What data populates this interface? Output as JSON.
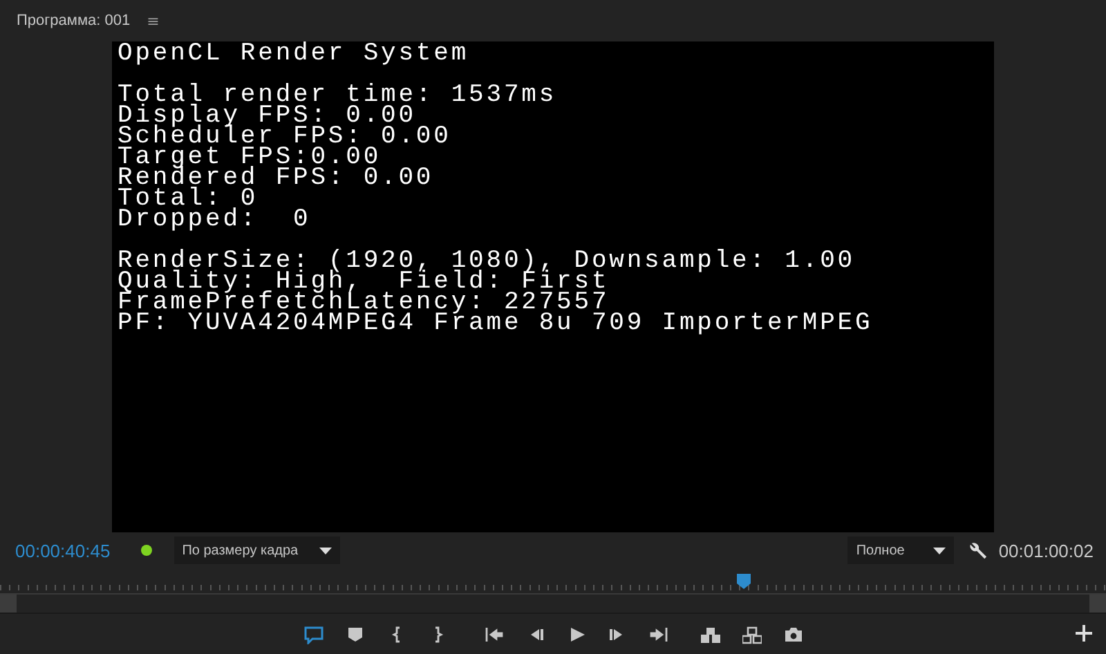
{
  "panel": {
    "title": "Программа: 001",
    "menu_glyph": "≡"
  },
  "video": {
    "groups": [
      [
        "OpenCL Render System"
      ],
      [
        "Total render time: 1537ms",
        "Display FPS: 0.00",
        "Scheduler FPS: 0.00",
        "Target FPS:0.00",
        "Rendered FPS: 0.00",
        "Total: 0",
        "Dropped:  0"
      ],
      [
        "RenderSize: (1920, 1080), Downsample: 1.00",
        "Quality: High,  Field: First",
        "FramePrefetchLatency: 227557",
        "PF: YUVA4204MPEG4 Frame 8u 709 ImporterMPEG"
      ]
    ]
  },
  "status": {
    "timecode": "00:00:40:45",
    "zoom_select": "По размеру кадра",
    "quality_select": "Полное",
    "duration": "00:01:00:02"
  },
  "timeline": {
    "level": 0.673
  },
  "transport": [
    {
      "kind": "marker-comment",
      "active": true
    },
    {
      "kind": "marker",
      "active": false
    },
    {
      "kind": "mark-in",
      "active": false
    },
    {
      "kind": "mark-out",
      "active": false
    },
    {
      "kind": "go-in",
      "active": false
    },
    {
      "kind": "step-back",
      "active": false
    },
    {
      "kind": "play",
      "active": false
    },
    {
      "kind": "step-forward",
      "active": false
    },
    {
      "kind": "go-out",
      "active": false
    },
    {
      "kind": "lift",
      "active": false
    },
    {
      "kind": "extract",
      "active": false
    },
    {
      "kind": "camera",
      "active": false
    }
  ]
}
